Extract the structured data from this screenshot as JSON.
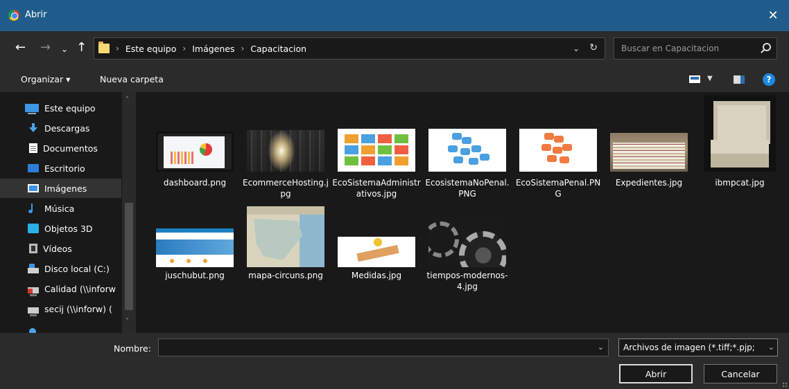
{
  "window": {
    "title": "Abrir",
    "close_glyph": "✕"
  },
  "nav": {
    "back_glyph": "←",
    "forward_glyph": "→",
    "recent_glyph": "⌄",
    "up_glyph": "↑",
    "breadcrumbs": [
      "Este equipo",
      "Imágenes",
      "Capacitacion"
    ],
    "separator": "›",
    "dropdown_glyph": "⌄",
    "refresh_glyph": "↻"
  },
  "search": {
    "placeholder": "Buscar en Capacitacion"
  },
  "toolbar": {
    "organize": "Organizar ▾",
    "new_folder": "Nueva carpeta",
    "view_drop": "▼",
    "help": "?"
  },
  "sidebar": {
    "items": [
      {
        "label": "Este equipo",
        "icon": "computer-icon"
      },
      {
        "label": "Descargas",
        "icon": "downloads-icon"
      },
      {
        "label": "Documentos",
        "icon": "documents-icon"
      },
      {
        "label": "Escritorio",
        "icon": "desktop-icon"
      },
      {
        "label": "Imágenes",
        "icon": "pictures-icon",
        "selected": true
      },
      {
        "label": "Música",
        "icon": "music-icon"
      },
      {
        "label": "Objetos 3D",
        "icon": "3d-objects-icon"
      },
      {
        "label": "Vídeos",
        "icon": "videos-icon"
      },
      {
        "label": "Disco local (C:)",
        "icon": "local-disk-icon"
      },
      {
        "label": "Calidad (\\\\inforw",
        "icon": "network-drive-disconnected-icon"
      },
      {
        "label": "secij (\\\\inforw) (",
        "icon": "network-drive-icon"
      }
    ],
    "scroll_up": "˄",
    "scroll_down": "˅"
  },
  "files": [
    {
      "name": "dashboard.png"
    },
    {
      "name": "EcommerceHosting.jpg"
    },
    {
      "name": "EcoSistemaAdministrativos.jpg"
    },
    {
      "name": "EcosistemaNoPenal.PNG"
    },
    {
      "name": "EcoSistemaPenal.PNG"
    },
    {
      "name": "Expedientes.jpg"
    },
    {
      "name": "ibmpcat.jpg"
    },
    {
      "name": "juschubut.png"
    },
    {
      "name": "mapa-circuns.png"
    },
    {
      "name": "Medidas.jpg"
    },
    {
      "name": "tiempos-modernos-4.jpg"
    }
  ],
  "footer": {
    "name_label": "Nombre:",
    "name_value": "",
    "dropdown_glyph": "⌄",
    "file_type": "Archivos de imagen (*.tiff;*.pjp;",
    "open_button": "Abrir",
    "cancel_button": "Cancelar"
  }
}
